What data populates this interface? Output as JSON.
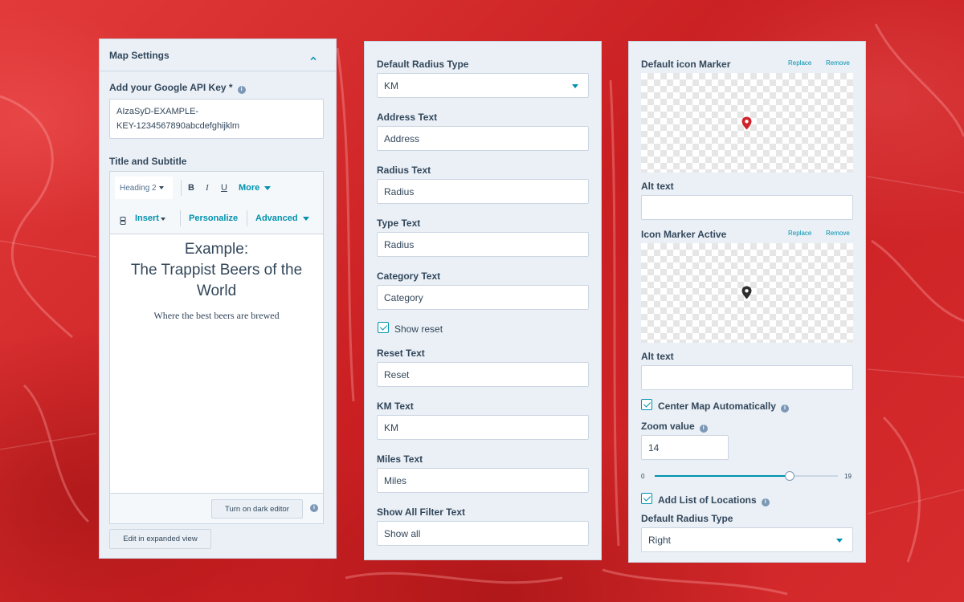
{
  "left": {
    "section_title": "Map Settings",
    "api_key_label": "Add your Google API Key *",
    "api_key_line1": "AIzaSyD-EXAMPLE-",
    "api_key_line2": "KEY-1234567890abcdefghijklm",
    "title_subtitle_label": "Title and Subtitle",
    "toolbar": {
      "heading_select": "Heading 2",
      "bold": "B",
      "italic": "I",
      "underline": "U",
      "more": "More",
      "insert": "Insert",
      "personalize": "Personalize",
      "advanced": "Advanced"
    },
    "editor": {
      "heading_line1": "Example:",
      "heading_line2": "The Trappist Beers of the",
      "heading_line3": "World",
      "subtitle": "Where the best beers are brewed"
    },
    "dark_editor_button": "Turn on dark editor",
    "expanded_view_button": "Edit in expanded view"
  },
  "middle": {
    "default_radius_type_label": "Default Radius Type",
    "default_radius_type_value": "KM",
    "address_text_label": "Address Text",
    "address_text_value": "Address",
    "radius_text_label": "Radius Text",
    "radius_text_value": "Radius",
    "type_text_label": "Type Text",
    "type_text_value": "Radius",
    "category_text_label": "Category Text",
    "category_text_value": "Category",
    "show_reset_label": "Show reset",
    "reset_text_label": "Reset Text",
    "reset_text_value": "Reset",
    "km_text_label": "KM Text",
    "km_text_value": "KM",
    "miles_text_label": "Miles Text",
    "miles_text_value": "Miles",
    "show_all_label": "Show All Filter Text",
    "show_all_value": "Show all"
  },
  "right": {
    "default_icon_label": "Default icon Marker",
    "replace": "Replace",
    "remove": "Remove",
    "alt_text_label": "Alt text",
    "active_icon_label": "Icon Marker Active",
    "center_map_label": "Center Map Automatically",
    "zoom_label": "Zoom value",
    "zoom_value": "14",
    "slider_min": "0",
    "slider_max": "19",
    "add_list_label": "Add List of Locations",
    "default_radius_type_label": "Default Radius Type",
    "default_radius_type_value": "Right"
  },
  "colors": {
    "accent": "#0091ae",
    "panel_bg": "#eaf0f6",
    "text": "#33475b",
    "marker_default": "#d0222a",
    "marker_active": "#2d2d2d"
  }
}
